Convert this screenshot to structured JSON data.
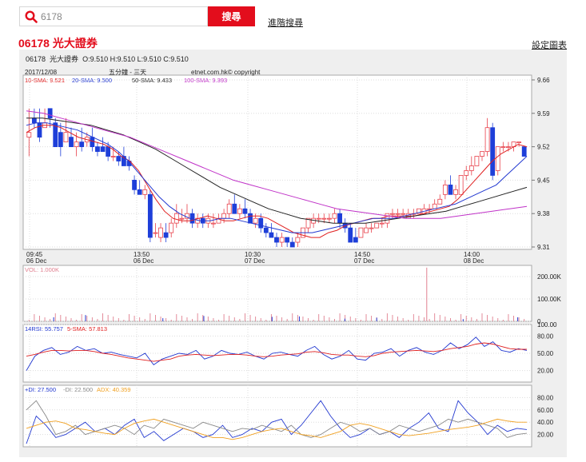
{
  "search": {
    "value": "6178",
    "button_label": "搜尋",
    "advanced_label": "進階搜尋"
  },
  "stock": {
    "code": "06178",
    "name": "光大證券",
    "settings_label": "設定圖表"
  },
  "ohlc": {
    "name": "光大證券",
    "open": "O:9.510",
    "high": "H:9.510",
    "low": "L:9.510",
    "close": "C:9.510"
  },
  "colors": {
    "accent": "#e30d1c",
    "up": "#e8404a",
    "down": "#1e3fd9",
    "sma10": "#e02020",
    "sma20": "#2238d0",
    "sma50": "#222222",
    "sma100": "#c032c8",
    "vol": "#e08090",
    "adx": "#f0a020",
    "pdi": "#2238d0",
    "mdi": "#888888"
  },
  "chart_data": [
    {
      "type": "candlestick",
      "header": {
        "date": "2017/12/08",
        "interval": "五分鐘 - 三天",
        "credit": "etnet.com.hk© copyright"
      },
      "legend": [
        {
          "name": "10-SMA",
          "value": "9.521"
        },
        {
          "name": "20-SMA",
          "value": "9.500"
        },
        {
          "name": "50-SMA",
          "value": "9.433"
        },
        {
          "name": "100-SMA",
          "value": "9.393"
        }
      ],
      "yticks": [
        9.66,
        9.59,
        9.52,
        9.45,
        9.38,
        9.31
      ],
      "ylim": [
        9.305,
        9.67
      ],
      "xticks": [
        {
          "time": "09:45",
          "day": "06 Dec"
        },
        {
          "time": "13:50",
          "day": "06 Dec"
        },
        {
          "time": "10:30",
          "day": "07 Dec"
        },
        {
          "time": "14:50",
          "day": "07 Dec"
        },
        {
          "time": "14:00",
          "day": "08 Dec"
        }
      ],
      "candles": [
        [
          9.54,
          9.6,
          9.55,
          9.5
        ],
        [
          9.58,
          9.6,
          9.57,
          9.56
        ],
        [
          9.57,
          9.6,
          9.54,
          9.53
        ],
        [
          9.56,
          9.6,
          9.57,
          9.56
        ],
        [
          9.6,
          9.6,
          9.58,
          9.56
        ],
        [
          9.57,
          9.58,
          9.52,
          9.52
        ],
        [
          9.55,
          9.57,
          9.52,
          9.5
        ],
        [
          9.53,
          9.58,
          9.55,
          9.53
        ],
        [
          9.54,
          9.56,
          9.52,
          9.52
        ],
        [
          9.52,
          9.55,
          9.53,
          9.5
        ],
        [
          9.53,
          9.56,
          9.52,
          9.51
        ],
        [
          9.53,
          9.55,
          9.54,
          9.52
        ],
        [
          9.54,
          9.56,
          9.52,
          9.51
        ],
        [
          9.52,
          9.53,
          9.51,
          9.5
        ],
        [
          9.52,
          9.54,
          9.51,
          9.51
        ],
        [
          9.52,
          9.53,
          9.5,
          9.49
        ],
        [
          9.5,
          9.52,
          9.5,
          9.49
        ],
        [
          9.5,
          9.51,
          9.49,
          9.48
        ],
        [
          9.5,
          9.52,
          9.48,
          9.48
        ],
        [
          9.49,
          9.5,
          9.48,
          9.47
        ],
        [
          9.45,
          9.46,
          9.43,
          9.42
        ],
        [
          9.43,
          9.45,
          9.42,
          9.42
        ],
        [
          9.42,
          9.44,
          9.43,
          9.41
        ],
        [
          9.42,
          9.43,
          9.33,
          9.32
        ],
        [
          9.34,
          9.36,
          9.34,
          9.33
        ],
        [
          9.33,
          9.36,
          9.35,
          9.32
        ],
        [
          9.34,
          9.36,
          9.33,
          9.32
        ],
        [
          9.34,
          9.37,
          9.36,
          9.33
        ],
        [
          9.36,
          9.4,
          9.38,
          9.35
        ],
        [
          9.37,
          9.39,
          9.37,
          9.36
        ],
        [
          9.37,
          9.4,
          9.38,
          9.36
        ],
        [
          9.38,
          9.39,
          9.36,
          9.35
        ],
        [
          9.36,
          9.38,
          9.37,
          9.35
        ],
        [
          9.37,
          9.38,
          9.36,
          9.35
        ],
        [
          9.36,
          9.38,
          9.37,
          9.35
        ],
        [
          9.36,
          9.38,
          9.36,
          9.35
        ],
        [
          9.36,
          9.38,
          9.37,
          9.36
        ],
        [
          9.37,
          9.39,
          9.38,
          9.36
        ],
        [
          9.38,
          9.41,
          9.4,
          9.37
        ],
        [
          9.4,
          9.42,
          9.38,
          9.38
        ],
        [
          9.38,
          9.4,
          9.39,
          9.37
        ],
        [
          9.39,
          9.41,
          9.38,
          9.37
        ],
        [
          9.38,
          9.39,
          9.36,
          9.36
        ],
        [
          9.36,
          9.38,
          9.37,
          9.35
        ],
        [
          9.37,
          9.38,
          9.35,
          9.34
        ],
        [
          9.35,
          9.36,
          9.34,
          9.33
        ],
        [
          9.34,
          9.36,
          9.33,
          9.33
        ],
        [
          9.33,
          9.34,
          9.32,
          9.31
        ],
        [
          9.32,
          9.34,
          9.33,
          9.31
        ],
        [
          9.33,
          9.33,
          9.32,
          9.31
        ],
        [
          9.32,
          9.33,
          9.31,
          9.31
        ],
        [
          9.32,
          9.34,
          9.33,
          9.31
        ],
        [
          9.33,
          9.35,
          9.35,
          9.33
        ],
        [
          9.35,
          9.37,
          9.37,
          9.34
        ],
        [
          9.36,
          9.38,
          9.37,
          9.35
        ],
        [
          9.37,
          9.38,
          9.37,
          9.36
        ],
        [
          9.37,
          9.38,
          9.37,
          9.36
        ],
        [
          9.37,
          9.38,
          9.37,
          9.36
        ],
        [
          9.37,
          9.39,
          9.38,
          9.36
        ],
        [
          9.38,
          9.39,
          9.36,
          9.35
        ],
        [
          9.36,
          9.37,
          9.35,
          9.34
        ],
        [
          9.35,
          9.36,
          9.32,
          9.32
        ],
        [
          9.33,
          9.35,
          9.32,
          9.32
        ],
        [
          9.33,
          9.35,
          9.35,
          9.33
        ],
        [
          9.34,
          9.36,
          9.35,
          9.34
        ],
        [
          9.35,
          9.36,
          9.35,
          9.34
        ],
        [
          9.35,
          9.36,
          9.36,
          9.35
        ],
        [
          9.36,
          9.37,
          9.36,
          9.35
        ],
        [
          9.36,
          9.38,
          9.38,
          9.35
        ],
        [
          9.38,
          9.39,
          9.38,
          9.37
        ],
        [
          9.38,
          9.39,
          9.38,
          9.37
        ],
        [
          9.38,
          9.39,
          9.38,
          9.37
        ],
        [
          9.37,
          9.39,
          9.38,
          9.37
        ],
        [
          9.38,
          9.39,
          9.38,
          9.37
        ],
        [
          9.38,
          9.39,
          9.39,
          9.38
        ],
        [
          9.38,
          9.4,
          9.39,
          9.38
        ],
        [
          9.39,
          9.4,
          9.39,
          9.38
        ],
        [
          9.39,
          9.41,
          9.4,
          9.39
        ],
        [
          9.4,
          9.42,
          9.41,
          9.4
        ],
        [
          9.42,
          9.45,
          9.44,
          9.41
        ],
        [
          9.44,
          9.46,
          9.42,
          9.42
        ],
        [
          9.42,
          9.44,
          9.43,
          9.41
        ],
        [
          9.42,
          9.46,
          9.46,
          9.42
        ],
        [
          9.46,
          9.48,
          9.47,
          9.45
        ],
        [
          9.47,
          9.5,
          9.48,
          9.46
        ],
        [
          9.48,
          9.5,
          9.5,
          9.48
        ],
        [
          9.5,
          9.51,
          9.51,
          9.49
        ],
        [
          9.51,
          9.58,
          9.56,
          9.5
        ],
        [
          9.56,
          9.57,
          9.46,
          9.45
        ],
        [
          9.47,
          9.52,
          9.52,
          9.46
        ],
        [
          9.52,
          9.53,
          9.52,
          9.51
        ],
        [
          9.52,
          9.53,
          9.52,
          9.51
        ],
        [
          9.52,
          9.53,
          9.53,
          9.51
        ],
        [
          9.53,
          9.53,
          9.53,
          9.52
        ],
        [
          9.52,
          9.52,
          9.5,
          9.5
        ]
      ],
      "series": [
        {
          "name": "10-SMA",
          "values": [
            9.55,
            9.56,
            9.565,
            9.565,
            9.56,
            9.55,
            9.54,
            9.535,
            9.53,
            9.525,
            9.515,
            9.5,
            9.49,
            9.47,
            9.44,
            9.41,
            9.385,
            9.37,
            9.365,
            9.365,
            9.37,
            9.375,
            9.37,
            9.365,
            9.365,
            9.37,
            9.375,
            9.375,
            9.37,
            9.36,
            9.35,
            9.34,
            9.335,
            9.33,
            9.33,
            9.34,
            9.345,
            9.355,
            9.36,
            9.365,
            9.37,
            9.37,
            9.375,
            9.375,
            9.375,
            9.375,
            9.38,
            9.385,
            9.39,
            9.395,
            9.41,
            9.43,
            9.45,
            9.47,
            9.49,
            9.505,
            9.515,
            9.525,
            9.52
          ]
        },
        {
          "name": "20-SMA",
          "values": [
            9.565,
            9.57,
            9.57,
            9.565,
            9.56,
            9.555,
            9.545,
            9.535,
            9.525,
            9.51,
            9.49,
            9.465,
            9.44,
            9.415,
            9.395,
            9.38,
            9.37,
            9.365,
            9.365,
            9.37,
            9.37,
            9.365,
            9.36,
            9.355,
            9.35,
            9.345,
            9.34,
            9.34,
            9.34,
            9.345,
            9.35,
            9.355,
            9.36,
            9.365,
            9.37,
            9.37,
            9.37,
            9.375,
            9.38,
            9.385,
            9.39,
            9.395,
            9.4,
            9.41,
            9.42,
            9.43,
            9.44,
            9.46,
            9.48,
            9.5
          ]
        },
        {
          "name": "50-SMA",
          "values": [
            9.58,
            9.58,
            9.575,
            9.57,
            9.565,
            9.555,
            9.545,
            9.53,
            9.515,
            9.495,
            9.475,
            9.455,
            9.435,
            9.42,
            9.405,
            9.39,
            9.38,
            9.37,
            9.365,
            9.36,
            9.36,
            9.36,
            9.365,
            9.37,
            9.375,
            9.38,
            9.385,
            9.395,
            9.405,
            9.415,
            9.425,
            9.435
          ]
        },
        {
          "name": "100-SMA",
          "values": [
            9.595,
            9.59,
            9.58,
            9.57,
            9.56,
            9.55,
            9.54,
            9.525,
            9.51,
            9.495,
            9.48,
            9.465,
            9.45,
            9.44,
            9.43,
            9.42,
            9.41,
            9.4,
            9.39,
            9.385,
            9.38,
            9.375,
            9.37,
            9.37,
            9.37,
            9.375,
            9.38,
            9.385,
            9.39,
            9.395
          ]
        }
      ]
    },
    {
      "type": "bar",
      "label": "VOL: 1.000K",
      "yticks": [
        "200.00K",
        "100.00K",
        "0"
      ],
      "ylim": [
        0,
        250
      ],
      "spikes": [
        {
          "x": 88,
          "value": 240
        },
        {
          "x": 13,
          "value": 28
        },
        {
          "x": 39,
          "value": 24
        },
        {
          "x": 54,
          "value": 20
        },
        {
          "x": 60,
          "value": 22
        },
        {
          "x": 6,
          "value": 18
        },
        {
          "x": 70,
          "value": 12
        },
        {
          "x": 30,
          "value": 14
        },
        {
          "x": 77,
          "value": 16
        },
        {
          "x": 96,
          "value": 10
        },
        {
          "x": 108,
          "value": 18
        }
      ]
    },
    {
      "type": "line",
      "label": "14RSI: 55.757",
      "label2": "5-SMA: 57.813",
      "yticks": [
        "100.00",
        "80.00",
        "50.00",
        "20.00"
      ],
      "ylim": [
        0,
        100
      ],
      "series": [
        {
          "name": "14RSI",
          "values": [
            20,
            45,
            55,
            60,
            48,
            52,
            62,
            55,
            58,
            50,
            52,
            48,
            45,
            42,
            50,
            30,
            40,
            45,
            50,
            48,
            55,
            40,
            45,
            55,
            50,
            48,
            52,
            45,
            40,
            50,
            52,
            48,
            45,
            55,
            62,
            48,
            40,
            45,
            55,
            40,
            38,
            50,
            52,
            58,
            45,
            55,
            60,
            52,
            48,
            55,
            68,
            58,
            65,
            78,
            62,
            70,
            55,
            52,
            58,
            55
          ]
        },
        {
          "name": "5-SMA",
          "values": [
            45,
            48,
            52,
            55,
            55,
            54,
            55,
            55,
            53,
            50,
            48,
            45,
            42,
            40,
            38,
            36,
            38,
            40,
            45,
            47,
            48,
            47,
            46,
            47,
            48,
            48,
            47,
            45,
            44,
            45,
            47,
            48,
            49,
            52,
            53,
            51,
            48,
            47,
            47,
            45,
            44,
            46,
            50,
            52,
            53,
            54,
            55,
            54,
            53,
            55,
            58,
            60,
            62,
            66,
            68,
            66,
            62,
            58,
            57,
            57
          ]
        }
      ]
    },
    {
      "type": "line",
      "label": "+DI: 27.500",
      "label2": "-DI: 22.500",
      "label3": "ADX: 40.359",
      "yticks": [
        "80.00",
        "60.00",
        "40.00",
        "20.00"
      ],
      "ylim": [
        0,
        100
      ],
      "series": [
        {
          "name": "+DI",
          "values": [
            5,
            50,
            35,
            15,
            20,
            30,
            40,
            25,
            30,
            20,
            35,
            45,
            15,
            25,
            10,
            20,
            30,
            25,
            15,
            20,
            35,
            15,
            20,
            30,
            25,
            40,
            45,
            20,
            35,
            55,
            75,
            50,
            30,
            15,
            20,
            30,
            20,
            25,
            15,
            30,
            40,
            55,
            30,
            25,
            75,
            55,
            40,
            20,
            35,
            25,
            30,
            28
          ]
        },
        {
          "name": "-DI",
          "values": [
            60,
            75,
            50,
            20,
            25,
            35,
            20,
            25,
            30,
            35,
            30,
            20,
            35,
            30,
            45,
            40,
            35,
            30,
            40,
            35,
            30,
            25,
            30,
            28,
            35,
            30,
            25,
            35,
            20,
            15,
            20,
            30,
            40,
            35,
            25,
            30,
            20,
            25,
            35,
            30,
            25,
            30,
            35,
            45,
            40,
            45,
            40,
            35,
            30,
            15,
            20,
            22
          ]
        },
        {
          "name": "ADX",
          "values": [
            30,
            35,
            40,
            42,
            38,
            30,
            28,
            25,
            22,
            20,
            30,
            38,
            42,
            45,
            40,
            35,
            30,
            25,
            20,
            15,
            15,
            12,
            15,
            20,
            25,
            28,
            30,
            25,
            20,
            18,
            15,
            20,
            25,
            35,
            38,
            35,
            30,
            25,
            20,
            18,
            20,
            22,
            25,
            28,
            30,
            32,
            35,
            40,
            45,
            42,
            40,
            40
          ]
        }
      ]
    }
  ]
}
